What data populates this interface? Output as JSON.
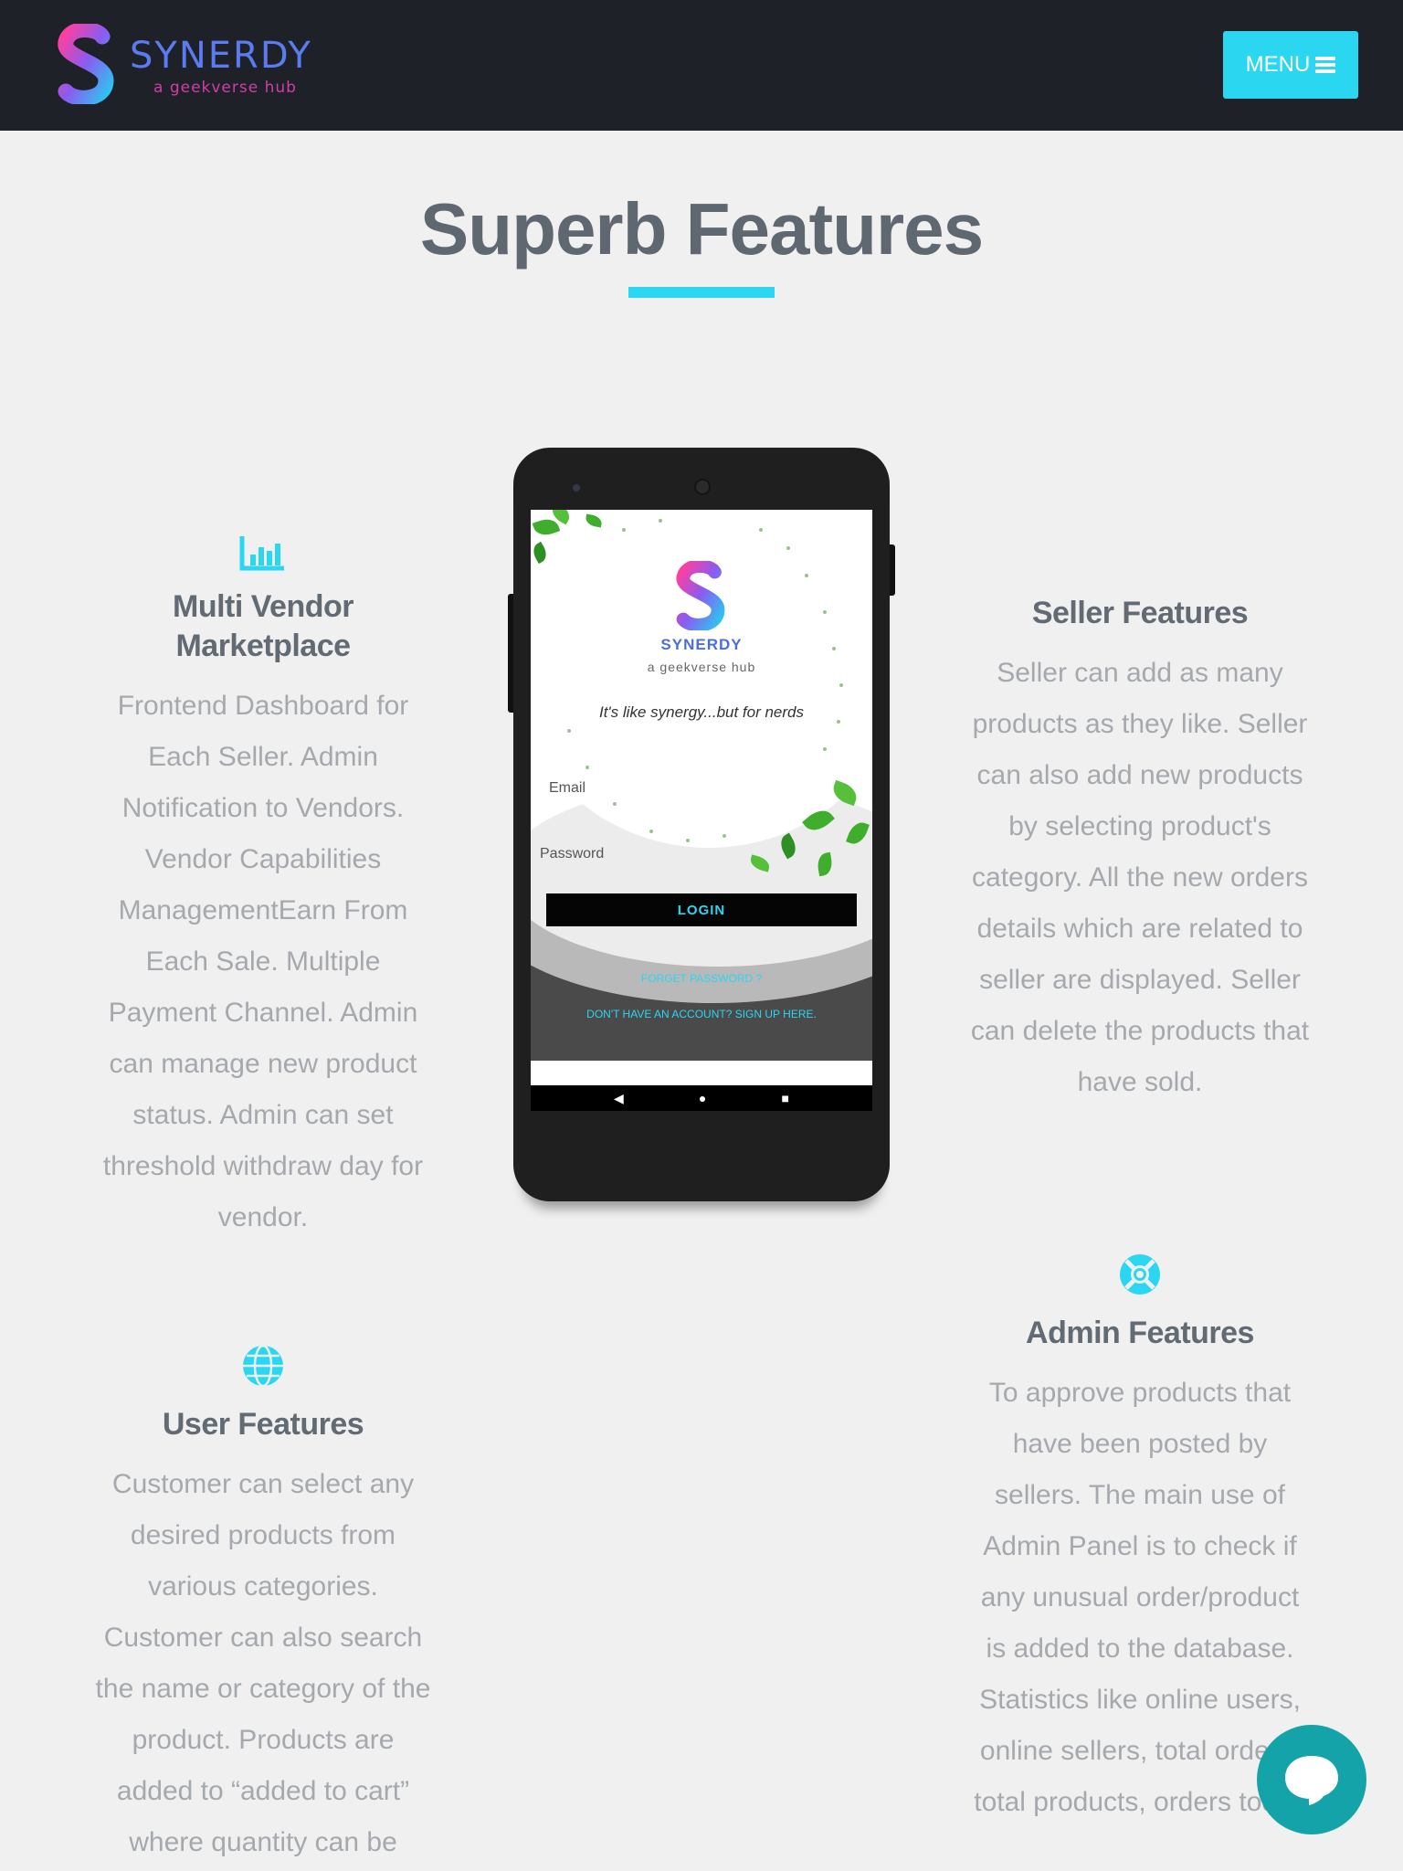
{
  "header": {
    "brand_name": "SYNERDY",
    "brand_tagline": "a geekverse hub",
    "menu_label": "MENU"
  },
  "section": {
    "title": "Superb Features"
  },
  "features": {
    "vendor": {
      "icon": "bar-chart-icon",
      "title": "Multi Vendor Marketplace",
      "text": "Frontend Dashboard for Each Seller. Admin Notification to Vendors. Vendor Capabilities ManagementEarn From Each Sale. Multiple Payment Channel. Admin can manage new product status. Admin can set threshold withdraw day for vendor."
    },
    "seller": {
      "title": "Seller Features",
      "text": "Seller can add as many products as they like. Seller can also add new products by selecting product's category. All the new orders details which are related to seller are displayed. Seller can delete the products that have sold."
    },
    "user": {
      "icon": "globe-icon",
      "title": "User Features",
      "text": "Customer can select any desired products from various categories. Customer can also search the name or category of the product. Products are added to “added to cart” where quantity can be"
    },
    "admin": {
      "icon": "lifebuoy-icon",
      "title": "Admin Features",
      "text": "To approve products that have been posted by sellers. The main use of Admin Panel is to check if any unusual order/product is added to the database. Statistics like online users, online sellers, total orders, total products, orders today"
    }
  },
  "phone_screen": {
    "brand_name": "SYNERDY",
    "brand_tagline": "a geekverse hub",
    "tagline": "It's like synergy...but for nerds",
    "email_placeholder": "Email",
    "password_placeholder": "Password",
    "login_label": "LOGIN",
    "forgot_label": "FORGET PASSWORD ?",
    "signup_label": "DON'T HAVE AN ACCOUNT? SIGN UP HERE.",
    "nav_back": "◀",
    "nav_home": "●",
    "nav_recent": "■"
  },
  "colors": {
    "accent": "#2bd6f0",
    "header_bg": "#1e2128",
    "chat_button": "#13a3a8"
  },
  "chat": {
    "icon": "chat-bubble-icon"
  }
}
